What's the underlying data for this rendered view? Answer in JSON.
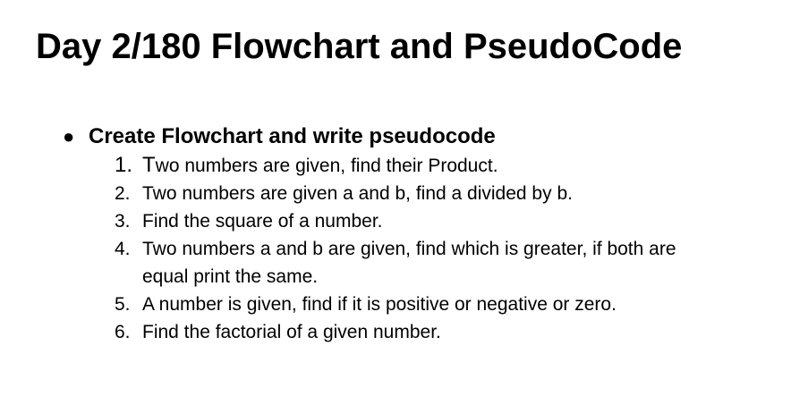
{
  "title": "Day 2/180 Flowchart and PseudoCode",
  "bullet": {
    "marker": "●",
    "text": "Create Flowchart and write pseudocode"
  },
  "items": [
    {
      "number": "1.",
      "first_letter": "T",
      "rest": "wo numbers are given, find their Product."
    },
    {
      "number": "2.",
      "text": "Two numbers are given a and b, find a divided by b."
    },
    {
      "number": "3.",
      "text": "Find the square of a number."
    },
    {
      "number": "4.",
      "text": "Two numbers a and b are given, find which is greater, if both are equal print the same."
    },
    {
      "number": "5.",
      "text": "A number is given, find if it is positive or negative or zero."
    },
    {
      "number": "6.",
      "text": "Find the factorial of a given number."
    }
  ]
}
